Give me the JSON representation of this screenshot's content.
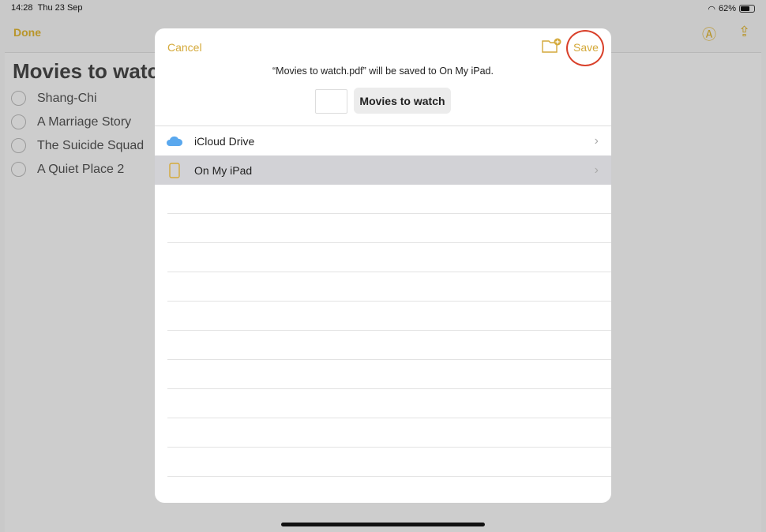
{
  "status": {
    "time": "14:28",
    "date": "Thu 23 Sep",
    "battery": "62%"
  },
  "toolbar": {
    "done": "Done",
    "markup_icon": "markup-pen-icon",
    "share_icon": "share-icon"
  },
  "note": {
    "title": "Movies to watch",
    "items": [
      "Shang-Chi",
      "A Marriage Story",
      "The Suicide Squad",
      "A Quiet Place 2"
    ]
  },
  "sheet": {
    "cancel": "Cancel",
    "save": "Save",
    "message": "“Movies to watch.pdf” will be saved to On My iPad.",
    "filename": "Movies to watch",
    "locations": [
      {
        "label": "iCloud Drive",
        "icon": "icloud-icon",
        "selected": false
      },
      {
        "label": "On My iPad",
        "icon": "ipad-icon",
        "selected": true
      }
    ]
  },
  "colors": {
    "accent": "#d4a93a",
    "highlight_ring": "#d9412b"
  }
}
